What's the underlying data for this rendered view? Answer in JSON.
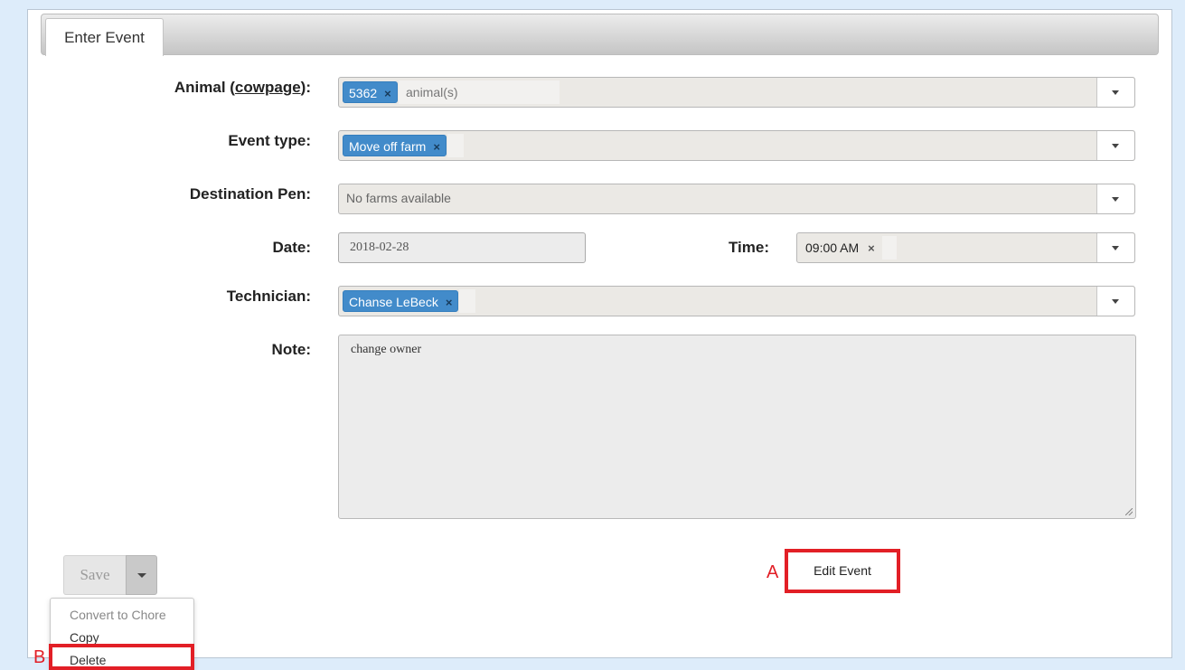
{
  "tab": {
    "label": "Enter Event"
  },
  "form": {
    "animal": {
      "label_prefix": "Animal (",
      "label_link": "cowpage",
      "label_suffix": "):",
      "chip": "5362",
      "placeholder": "animal(s)"
    },
    "event_type": {
      "label": "Event type:",
      "chip": "Move off farm"
    },
    "destination_pen": {
      "label": "Destination Pen:",
      "value": "No farms available"
    },
    "date": {
      "label": "Date:",
      "value": "2018-02-28"
    },
    "time": {
      "label": "Time:",
      "value": "09:00 AM"
    },
    "technician": {
      "label": "Technician:",
      "chip": "Chanse LeBeck"
    },
    "note": {
      "label": "Note:",
      "value": "change owner"
    }
  },
  "chip_remove_symbol": "×",
  "actions": {
    "save_label": "Save",
    "edit_event_label": "Edit Event",
    "menu": [
      {
        "label": "Convert to Chore",
        "disabled": true
      },
      {
        "label": "Copy",
        "disabled": false
      },
      {
        "label": "Delete",
        "disabled": false
      }
    ]
  },
  "annotations": {
    "a": "A",
    "b": "B",
    "color": "#e21f26"
  },
  "colors": {
    "chip": "#428bca",
    "background": "#ddecfa"
  }
}
